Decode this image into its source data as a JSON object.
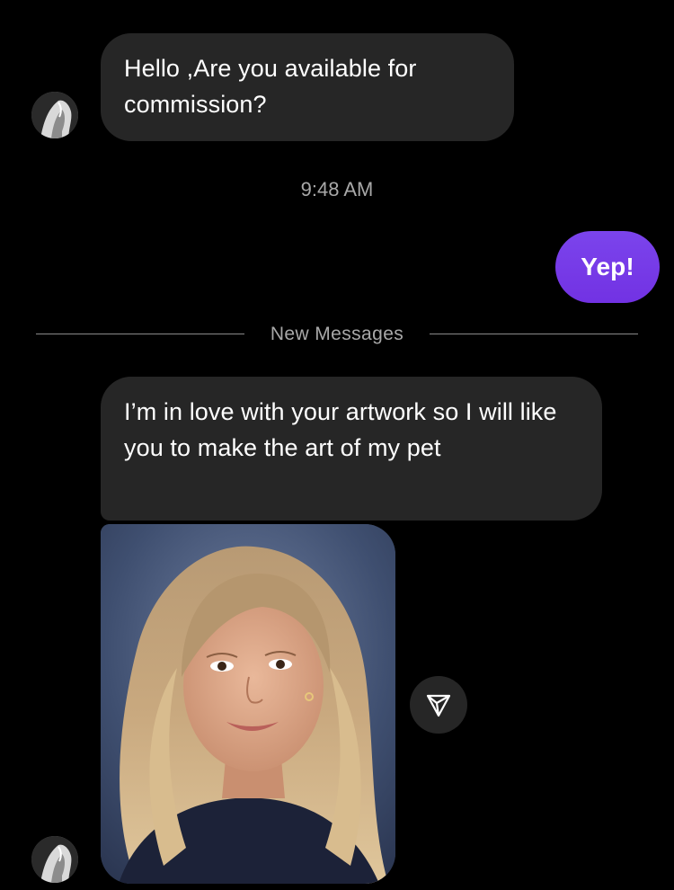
{
  "conversation": {
    "messages": [
      {
        "sender": "them",
        "text": "Hello ,Are you available for commission?"
      },
      {
        "sender": "me",
        "text": "Yep!"
      },
      {
        "sender": "them",
        "text": "I’m in love with your artwork so I will like you to make the art of my pet"
      }
    ],
    "timestamp": "9:48 AM",
    "new_messages_divider": "New Messages"
  },
  "colors": {
    "background": "#000000",
    "incoming_bubble": "#262626",
    "outgoing_bubble": "#7a3ee8",
    "secondary_text": "#a8a8a8"
  },
  "icons": {
    "share": "paper-plane-icon"
  }
}
